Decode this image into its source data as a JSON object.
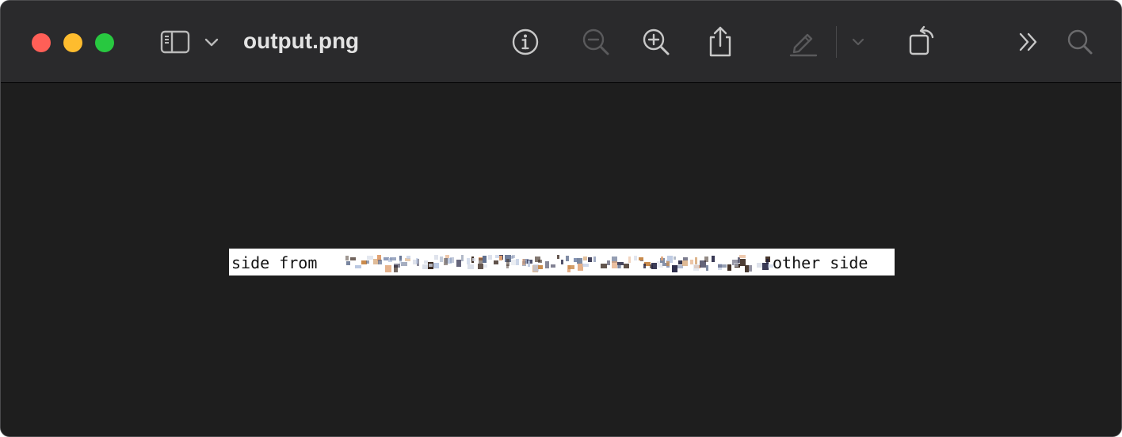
{
  "window": {
    "title": "output.png",
    "traffic_lights": {
      "close_color": "#ff5f57",
      "minimize_color": "#febc2e",
      "zoom_color": "#28c840"
    }
  },
  "toolbar": {
    "icons": [
      "sidebar-icon",
      "chevron-down-icon",
      "info-icon",
      "zoom-out-icon",
      "zoom-in-icon",
      "share-icon",
      "markup-pen-icon",
      "chevron-down-icon",
      "rotate-icon",
      "more-chevrons-icon",
      "search-icon"
    ],
    "disabled_icons": [
      "zoom-out-icon",
      "markup-pen-icon",
      "chevron-down-icon"
    ]
  },
  "image": {
    "left_text": "side from",
    "right_text": "other side",
    "middle_description_hidden": true
  }
}
